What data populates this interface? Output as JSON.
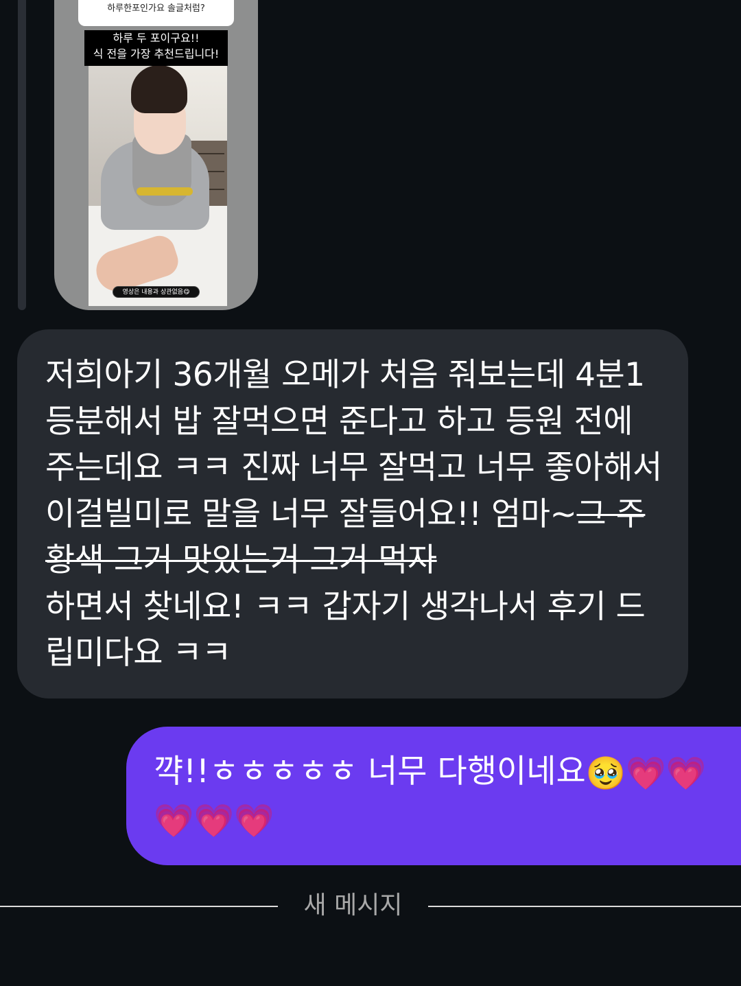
{
  "story_reply": {
    "question_line": "하루한포인가요 솔글처럼?",
    "caption_line1": "하루 두 포이구요!!",
    "caption_line2": "식 전을 가장 추천드립니다!",
    "video_note": "영상은 내용과 상관없음😋"
  },
  "incoming_message": {
    "text_before": "저희아기 36개월 오메가 처음 줘보는데 4분1등분해서 밥 잘먹으면 준다고 하고 등원 전에 주는데요 ㅋㅋ 진짜 너무 잘먹고 너무 좋아해서 이걸빌미로 말을 너무 잘들어요!! 엄마~",
    "text_strike": "그 주황색 그거 맛있는거 그거 먹자",
    "text_after": "하면서 찾네요! ㅋㅋ 갑자기 생각나서 후기 드립미다요 ㅋㅋ"
  },
  "outgoing_message": {
    "text": "꺅!!ㅎㅎㅎㅎㅎ 너무 다행이네요",
    "emoji_1": "🥹",
    "hearts_line1": "💗💗",
    "hearts_line2": "💗💗💗"
  },
  "divider": {
    "label": "새 메시지"
  },
  "colors": {
    "background": "#0c1014",
    "incoming_bubble": "#262a30",
    "outgoing_bubble": "#6b3bf0"
  }
}
